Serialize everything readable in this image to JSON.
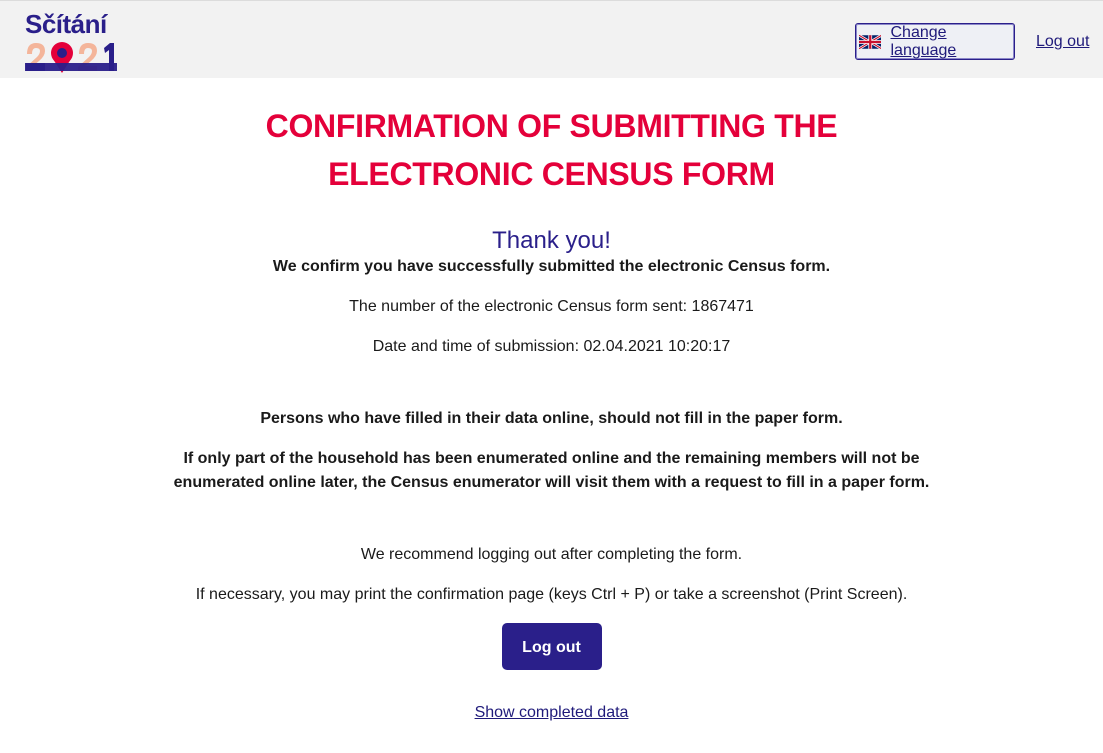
{
  "header": {
    "logo_word": "Sčítání",
    "logo_year": "2021",
    "change_language": "Change language",
    "logout_link": "Log out",
    "flag_icon": "uk-flag-icon"
  },
  "colors": {
    "brand_navy": "#2a1f8a",
    "title_red": "#e4003a",
    "logo_peach": "#f4b59a",
    "header_bg": "#f2f2f2"
  },
  "main": {
    "title_line1": "CONFIRMATION OF SUBMITTING THE",
    "title_line2": "ELECTRONIC CENSUS FORM",
    "thank_you": "Thank you!",
    "confirm_text": "We confirm you have successfully submitted the electronic Census form.",
    "form_number": "The number of the electronic Census form sent: 1867471",
    "submission_date": "Date and time of submission: 02.04.2021 10:20:17",
    "notice_paper": "Persons who have filled in their data online, should not fill in the paper form.",
    "notice_household": "If only part of the household has been enumerated online and the remaining members will not be enumerated online later, the Census enumerator will visit them with a request to fill in a paper form.",
    "recommend_logout": "We recommend logging out after completing the form.",
    "print_hint": "If necessary, you may print the confirmation page (keys Ctrl + P) or take a screenshot (Print Screen).",
    "logout_button": "Log out",
    "show_data_link": "Show completed data"
  }
}
